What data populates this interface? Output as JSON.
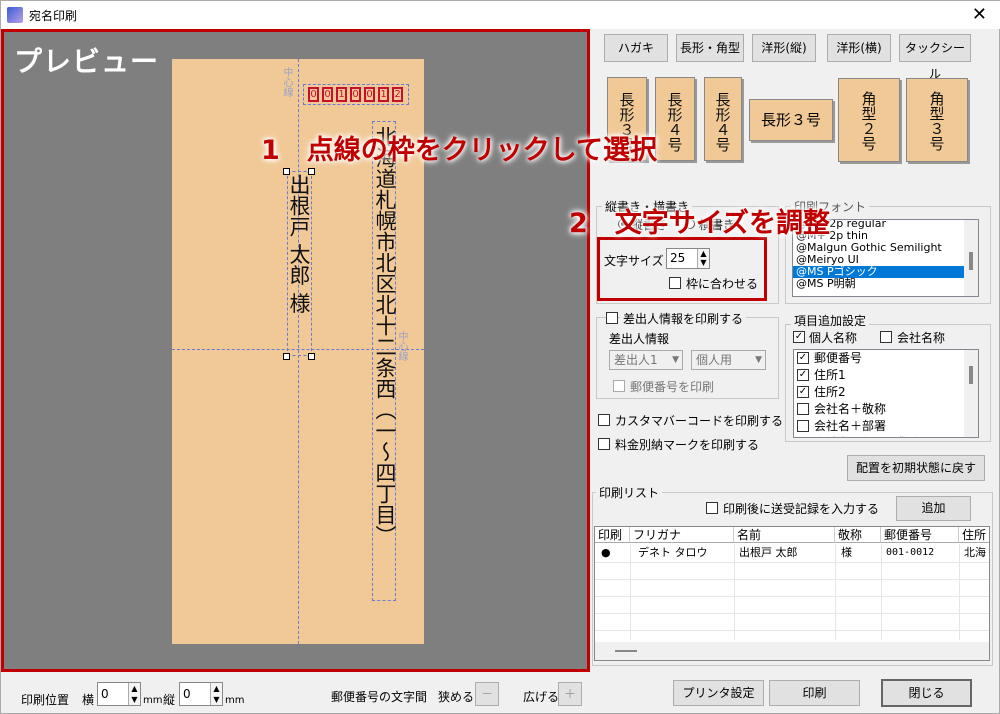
{
  "window": {
    "title": "宛名印刷",
    "close": "✕"
  },
  "preview": {
    "label": "プレビュー",
    "center_mark": "中心線",
    "center_mark_h": "中心線",
    "zip_digits": [
      "0",
      "0",
      "1",
      "0",
      "0",
      "1",
      "2"
    ],
    "name_text": "出根戸 太郎 様",
    "address_text": "北海道札幌市北区北十二条西（一〜四丁目）"
  },
  "annotations": {
    "step1": "1　点線の枠をクリックして選択",
    "step2": "2　文字サイズを調整"
  },
  "envelope_buttons": [
    "ハガキ",
    "長形・角型",
    "洋形(縦)",
    "洋形(横)",
    "タックシール"
  ],
  "envelope_tiles": {
    "naga3a": "長形３号",
    "naga4a": "長形４号",
    "naga4b": "長形４号",
    "naga3h": "長形３号",
    "kaku2": "角型２号",
    "kaku3": "角型３号"
  },
  "orientation": {
    "group": "縦書き・横書き",
    "vertical": "縦書き",
    "horizontal": "横書き"
  },
  "font_group": {
    "label": "印刷フォント",
    "items": [
      "@M+ 2p regular",
      "@M+ 2p thin",
      "@Malgun Gothic Semilight",
      "@Meiryo UI",
      "@MS Pゴシック",
      "@MS P明朝"
    ],
    "selected": "@MS Pゴシック"
  },
  "font_size": {
    "label": "文字サイズ",
    "value": "25",
    "fit_label": "枠に合わせる"
  },
  "sender": {
    "checkbox": "差出人情報を印刷する",
    "info_label": "差出人情報",
    "combo1": "差出人1",
    "combo2": "個人用",
    "zip_checkbox": "郵便番号を印刷"
  },
  "fields": {
    "label": "項目追加設定",
    "personal": "個人名称",
    "company": "会社名称",
    "items": [
      {
        "label": "郵便番号",
        "checked": true
      },
      {
        "label": "住所1",
        "checked": true
      },
      {
        "label": "住所2",
        "checked": true
      },
      {
        "label": "会社名＋敬称",
        "checked": false
      },
      {
        "label": "会社名＋部署",
        "checked": false
      },
      {
        "label": "会社名＋部署＋敬称",
        "checked": false
      }
    ]
  },
  "options": {
    "barcode": "カスタマバーコードを印刷する",
    "postage": "料金別納マークを印刷する"
  },
  "reset_button": "配置を初期状態に戻す",
  "print_list": {
    "label": "印刷リスト",
    "record_checkbox": "印刷後に送受記録を入力する",
    "add_button": "追加",
    "columns": [
      "印刷",
      "フリガナ",
      "名前",
      "敬称",
      "郵便番号",
      "住所"
    ],
    "rows": [
      {
        "print": "●",
        "furigana": "デネト タロウ",
        "name": "出根戸 太郎",
        "honorific": "様",
        "zip": "001-0012",
        "address": "北海"
      }
    ]
  },
  "bottom": {
    "print_pos": "印刷位置",
    "horizontal": "横",
    "vertical": "縦",
    "x_value": "0",
    "y_value": "0",
    "mm1": "mm",
    "mm2": "mm",
    "zip_spacing": "郵便番号の文字間",
    "narrow": "狭める",
    "narrow_btn": "－",
    "widen": "広げる",
    "widen_btn": "＋",
    "printer_btn": "プリンタ設定",
    "print_btn": "印刷",
    "close_btn": "閉じる"
  }
}
